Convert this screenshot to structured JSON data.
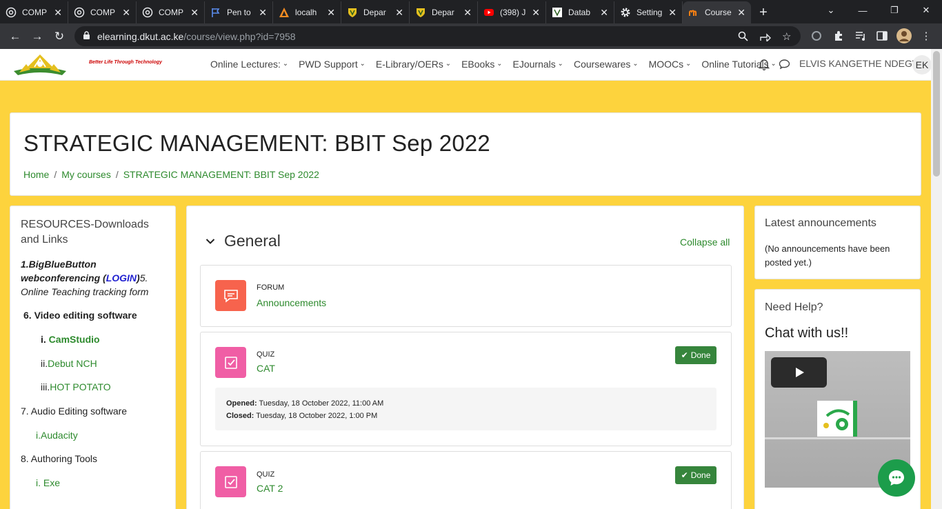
{
  "browser": {
    "tabs": [
      {
        "title": "COMP",
        "icon": "globe-icon"
      },
      {
        "title": "COMP",
        "icon": "globe-icon"
      },
      {
        "title": "COMP",
        "icon": "globe-icon"
      },
      {
        "title": "Pen to",
        "icon": "flag-icon"
      },
      {
        "title": "localh",
        "icon": "xampp-icon"
      },
      {
        "title": "Depar",
        "icon": "dkut-shield-icon"
      },
      {
        "title": "Depar",
        "icon": "dkut-shield-icon"
      },
      {
        "title": "(398) J",
        "icon": "youtube-icon"
      },
      {
        "title": "Datab",
        "icon": "database-icon"
      },
      {
        "title": "Setting",
        "icon": "gear-icon"
      },
      {
        "title": "Course",
        "icon": "moodle-icon",
        "active": true
      }
    ],
    "url_host": "elearning.dkut.ac.ke",
    "url_path": "/course/view.php?id=7958"
  },
  "header": {
    "tagline": "Better Life Through Technology",
    "nav": [
      "Online Lectures:",
      "PWD Support",
      "E-Library/OERs",
      "EBooks",
      "EJournals",
      "Coursewares",
      "MOOCs",
      "Online Tutorials"
    ],
    "username": "ELVIS KANGETHE NDEGWA",
    "avatar": "EK"
  },
  "page": {
    "title": "STRATEGIC MANAGEMENT: BBIT Sep 2022",
    "breadcrumb": [
      "Home",
      "My courses",
      "STRATEGIC MANAGEMENT: BBIT Sep 2022"
    ]
  },
  "left_block": {
    "title": "RESOURCES-Downloads and Links",
    "bbb_prefix": "1.BigBlueButton webconferencing (",
    "bbb_login": "LOGIN",
    "bbb_suffix": ")",
    "online_teaching": "5. Online Teaching tracking form",
    "video_heading": "6. Video editing software",
    "cam_num": "i. ",
    "cam": "CamStudio",
    "debut_num": "ii.",
    "debut": "Debut NCH",
    "hot_num": "iii.",
    "hot": "HOT POTATO",
    "audio_heading": "7. Audio Editing software",
    "audacity": "i.Audacity",
    "authoring_heading": "8. Authoring Tools",
    "exe": "i. Exe"
  },
  "main": {
    "section_title": "General",
    "collapse_all": "Collapse all",
    "activities": [
      {
        "kind": "FORUM",
        "name": "Announcements",
        "color": "#f7634d"
      },
      {
        "kind": "QUIZ",
        "name": "CAT",
        "color": "#f05ea5",
        "status": "Done",
        "opened_label": "Opened:",
        "opened": "Tuesday, 18 October 2022, 11:00 AM",
        "closed_label": "Closed:",
        "closed": "Tuesday, 18 October 2022, 1:00 PM"
      },
      {
        "kind": "QUIZ",
        "name": "CAT 2",
        "color": "#f05ea5",
        "status": "Done"
      }
    ]
  },
  "right": {
    "announcements_title": "Latest announcements",
    "announcements_text": "(No announcements have been posted yet.)",
    "help_title": "Need Help?",
    "chat_title": "Chat with us!!"
  }
}
